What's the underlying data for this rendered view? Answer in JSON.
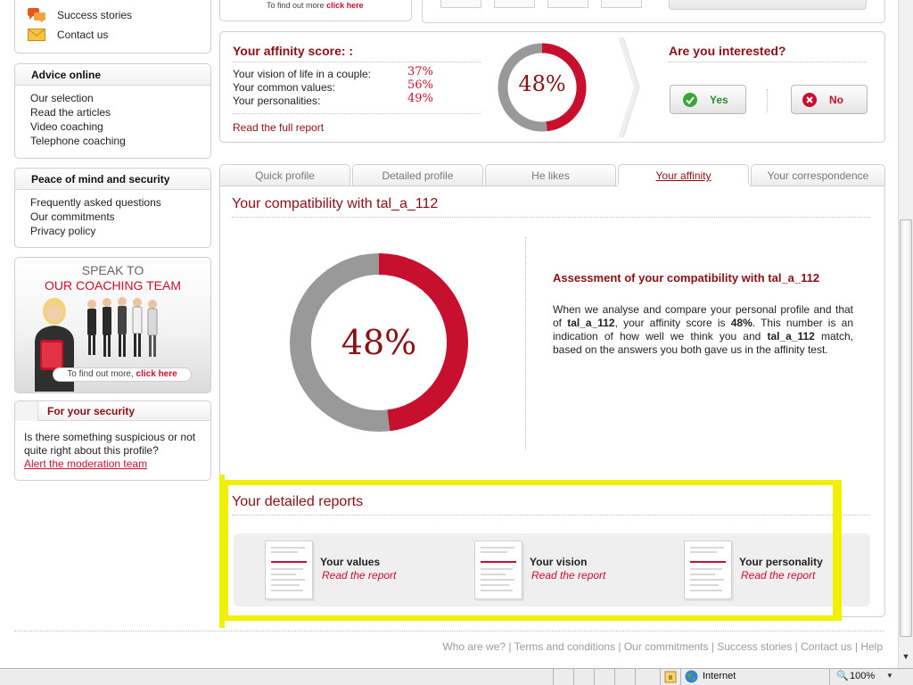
{
  "sidebar": {
    "top_items": [
      {
        "label": "Success stories",
        "icon": "speech-bubbles-icon"
      },
      {
        "label": "Contact us",
        "icon": "envelope-icon"
      }
    ],
    "advice": {
      "title": "Advice online",
      "items": [
        "Our selection",
        "Read the articles",
        "Video coaching",
        "Telephone coaching"
      ]
    },
    "peace": {
      "title": "Peace of mind and security",
      "items": [
        "Frequently asked questions",
        "Our commitments",
        "Privacy policy"
      ]
    },
    "coaching_banner": {
      "line1": "SPEAK TO",
      "line2": "OUR COACHING TEAM",
      "cta_text": "To find out more,",
      "cta_link": "click here"
    },
    "security": {
      "title": "For your security",
      "text": "Is there something suspicious or not quite right about this profile?",
      "link": "Alert the moderation team"
    }
  },
  "top_banner": {
    "text": "To find out more",
    "link": "click here"
  },
  "affinity_panel": {
    "title": "Your affinity score: :",
    "rows": [
      {
        "label": "Your vision of life in a couple:",
        "value": "37%"
      },
      {
        "label": "Your common values:",
        "value": "56%"
      },
      {
        "label": "Your personalities:",
        "value": "49%"
      }
    ],
    "link": "Read the full report",
    "score": "48%",
    "score_fraction": 0.48,
    "interest_title": "Are you interested?",
    "yes": "Yes",
    "no": "No"
  },
  "tabs": [
    {
      "label": "Quick profile",
      "active": false
    },
    {
      "label": "Detailed profile",
      "active": false
    },
    {
      "label": "He likes",
      "active": false
    },
    {
      "label": "Your affinity",
      "active": true
    },
    {
      "label": "Your correspondence",
      "active": false
    }
  ],
  "compatibility": {
    "title": "Your compatibility with tal_a_112",
    "score": "48%",
    "score_fraction": 0.48,
    "assessment_title": "Assessment of your compatibility with tal_a_112",
    "text_1": "When we analyse and compare your personal profile and that of",
    "username": "tal_a_112",
    "text_2": ", your affinity score is",
    "score_bold": "48%",
    "text_3": ". This number is an indication of how well we think you and",
    "text_4": "match, based on the answers you both gave us in the affinity test."
  },
  "reports": {
    "title": "Your detailed reports",
    "items": [
      {
        "title": "Your values",
        "link": "Read the report"
      },
      {
        "title": "Your vision",
        "link": "Read the report"
      },
      {
        "title": "Your personality",
        "link": "Read the report"
      }
    ]
  },
  "footer": {
    "links": [
      "Who are we?",
      "Terms and conditions",
      "Our commitments",
      "Success stories",
      "Contact us",
      "Help"
    ]
  },
  "statusbar": {
    "zone": "Internet",
    "zoom": "100%"
  },
  "colors": {
    "accent_red": "#c8102e",
    "dark_red": "#8b1015",
    "donut_grey": "#999999",
    "highlight_yellow": "#f0f000",
    "yes_green": "#3aa63a"
  }
}
